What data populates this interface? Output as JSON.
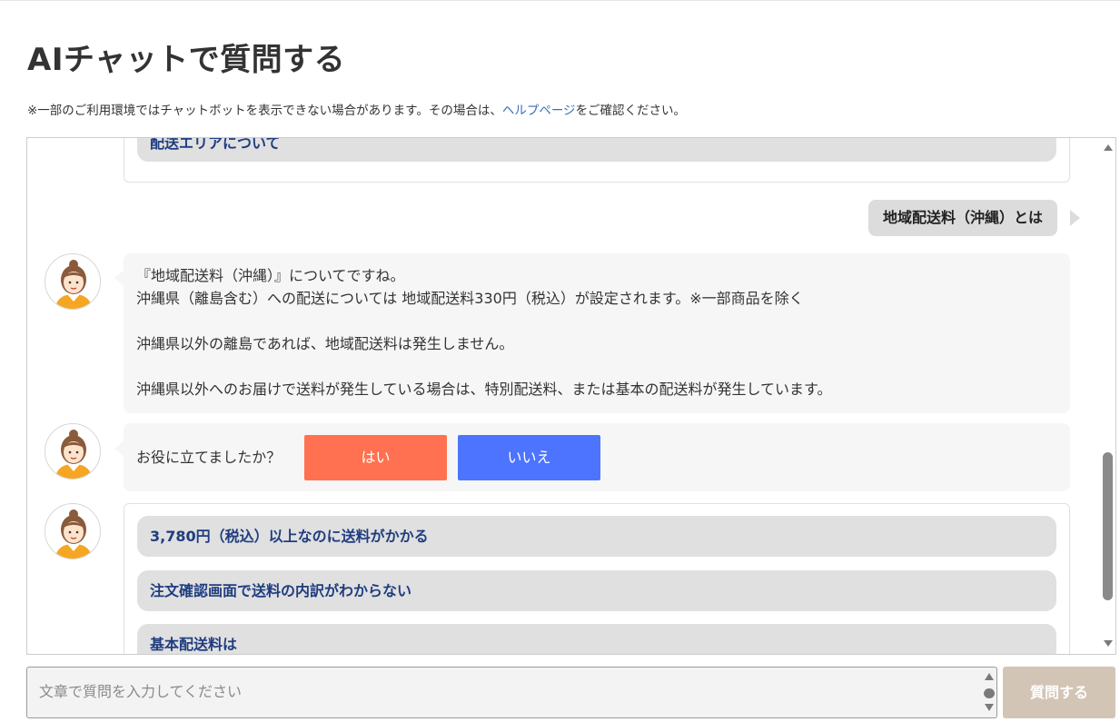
{
  "page": {
    "title": "AIチャットで質問する",
    "notice_before": "※一部のご利用環境ではチャットボットを表示できない場合があります。その場合は、",
    "notice_link": "ヘルプページ",
    "notice_after": "をご確認ください。"
  },
  "chat": {
    "prev_choices": [
      "配送エリアについて"
    ],
    "user_message": "地域配送料（沖縄）とは",
    "bot_answer": {
      "lines": [
        "『地域配送料（沖縄）』についてですね。",
        "沖縄県（離島含む）への配送については 地域配送料330円（税込）が設定されます。※一部商品を除く",
        "",
        "沖縄県以外の離島であれば、地域配送料は発生しません。",
        "",
        "沖縄県以外へのお届けで送料が発生している場合は、特別配送料、または基本の配送料が発生しています。"
      ]
    },
    "feedback": {
      "question": "お役に立てましたか？",
      "yes_label": "はい",
      "no_label": "いいえ",
      "yes_color": "#ff7150",
      "no_color": "#4d74ff"
    },
    "suggestions": [
      "3,780円（税込）以上なのに送料がかかる",
      "注文確認画面で送料の内訳がわからない",
      "基本配送料は"
    ],
    "avatar_icon": "bot-avatar-icon"
  },
  "input": {
    "placeholder": "文章で質問を入力してください",
    "value": ""
  },
  "send_button": {
    "label": "質問する",
    "color": "#d3c5b6"
  }
}
